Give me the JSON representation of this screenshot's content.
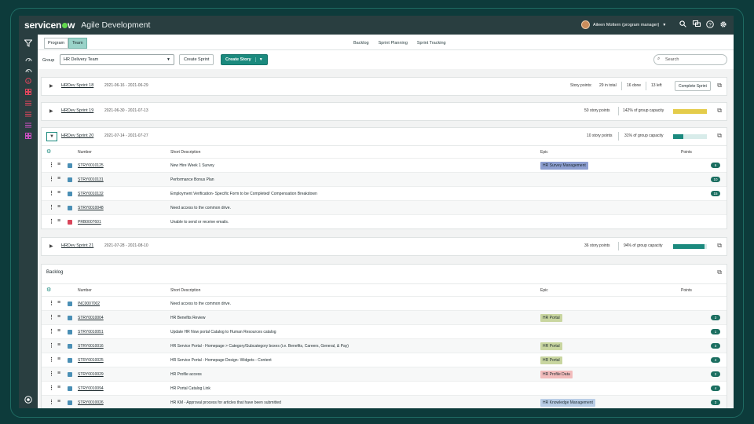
{
  "brand": {
    "logo_pre": "servicen",
    "logo_post": "w",
    "app_title": "Agile Development"
  },
  "user": {
    "name": "Aileen Mottern (program manager)"
  },
  "scope": {
    "options": [
      "Program",
      "Team"
    ],
    "active": "Team"
  },
  "tabs": [
    {
      "label": "Backlog",
      "active": false
    },
    {
      "label": "Sprint Planning",
      "active": true
    },
    {
      "label": "Sprint Tracking",
      "active": false
    }
  ],
  "toolbar": {
    "group_label": "Group",
    "group_value": "HR Delivery Team",
    "create_sprint": "Create Sprint",
    "create_story": "Create Story",
    "search_placeholder": "Search"
  },
  "columns": {
    "number": "Number",
    "short_description": "Short Description",
    "epic": "Epic",
    "points": "Points"
  },
  "colors": {
    "accent": "#1b8a7e",
    "nav_bg": "#293e40",
    "cap_ok": "#1b8a7e",
    "cap_over": "#e4cc4b"
  },
  "sprints": [
    {
      "name": "HRDev Sprint 18",
      "dates": "2021-06-16 - 2021-06-29",
      "sp_label": "Story points:",
      "in_total": "29 in total",
      "done": "16 done",
      "left": "13 left",
      "complete": "Complete Sprint"
    },
    {
      "name": "HRDev Sprint 19",
      "dates": "2021-06-30 - 2021-07-13",
      "points": "50 story points",
      "capacity": "142% of group capacity",
      "capacity_pct": 142
    },
    {
      "name": "HRDev Sprint 20",
      "dates": "2021-07-14 - 2021-07-27",
      "points": "10 story points",
      "capacity": "31% of group capacity",
      "capacity_pct": 31,
      "rows": [
        {
          "number": "STRY0010125",
          "desc": "New Hire Week 1 Survey",
          "epic": "HR Survey Management",
          "points": "6",
          "type": "story"
        },
        {
          "number": "STRY0010131",
          "desc": "Performance Bonus Plan",
          "epic": "",
          "points": "10",
          "type": "story"
        },
        {
          "number": "STRY0010132",
          "desc": "Employment Verification- Specific Form to be Completed/ Compensation Breakdown",
          "epic": "",
          "points": "15",
          "type": "story"
        },
        {
          "number": "STRY0010048",
          "desc": "Need access to the common drive.",
          "epic": "",
          "points": "",
          "type": "story"
        },
        {
          "number": "PRB0007601",
          "desc": "Unable to send or receive emails.",
          "epic": "",
          "points": "",
          "type": "problem"
        }
      ]
    },
    {
      "name": "HRDev Sprint 21",
      "dates": "2021-07-28 - 2021-08-10",
      "points": "36 story points",
      "capacity": "94% of group capacity",
      "capacity_pct": 94
    }
  ],
  "backlog": {
    "title": "Backlog",
    "rows": [
      {
        "number": "INC0007002",
        "desc": "Need access to the common drive.",
        "epic": "",
        "points": "",
        "type": "incident"
      },
      {
        "number": "STRY0010004",
        "desc": "HR Benefits Review",
        "epic": "HR Portal",
        "points": "3",
        "type": "story"
      },
      {
        "number": "STRY0010051",
        "desc": "Update HR Now portal Catalog to Human Resources catalog",
        "epic": "",
        "points": "1",
        "type": "story"
      },
      {
        "number": "STRY0010016",
        "desc": "HR Service Portal - Homepage > Category/Subcategory boxes (i.e. Benefits, Careers, General, & Pay)",
        "epic": "HR Portal",
        "points": "3",
        "type": "story"
      },
      {
        "number": "STRY0010025",
        "desc": "HR Service Portal - Homepage Design- Widgets - Content",
        "epic": "HR Portal",
        "points": "4",
        "type": "story"
      },
      {
        "number": "STRY0010029",
        "desc": "HR Profile access",
        "epic": "HR Profile Data",
        "points": "2",
        "type": "story"
      },
      {
        "number": "STRY0010094",
        "desc": "HR Portal Catalog Link",
        "epic": "",
        "points": "4",
        "type": "story"
      },
      {
        "number": "STRY0010026",
        "desc": "HR KM - Approval process for articles that have been submitted",
        "epic": "HR Knowledge Management",
        "points": "3",
        "type": "story"
      }
    ]
  },
  "epic_colors": {
    "HR Survey Management": "#8e9fd1",
    "HR Portal": "#c9d6a0",
    "HR Profile Data": "#f2bcbc",
    "HR Knowledge Management": "#b9cde6"
  },
  "type_colors": {
    "story": "#4a8fb5",
    "problem": "#d9455a",
    "incident": "#4a8fb5"
  }
}
